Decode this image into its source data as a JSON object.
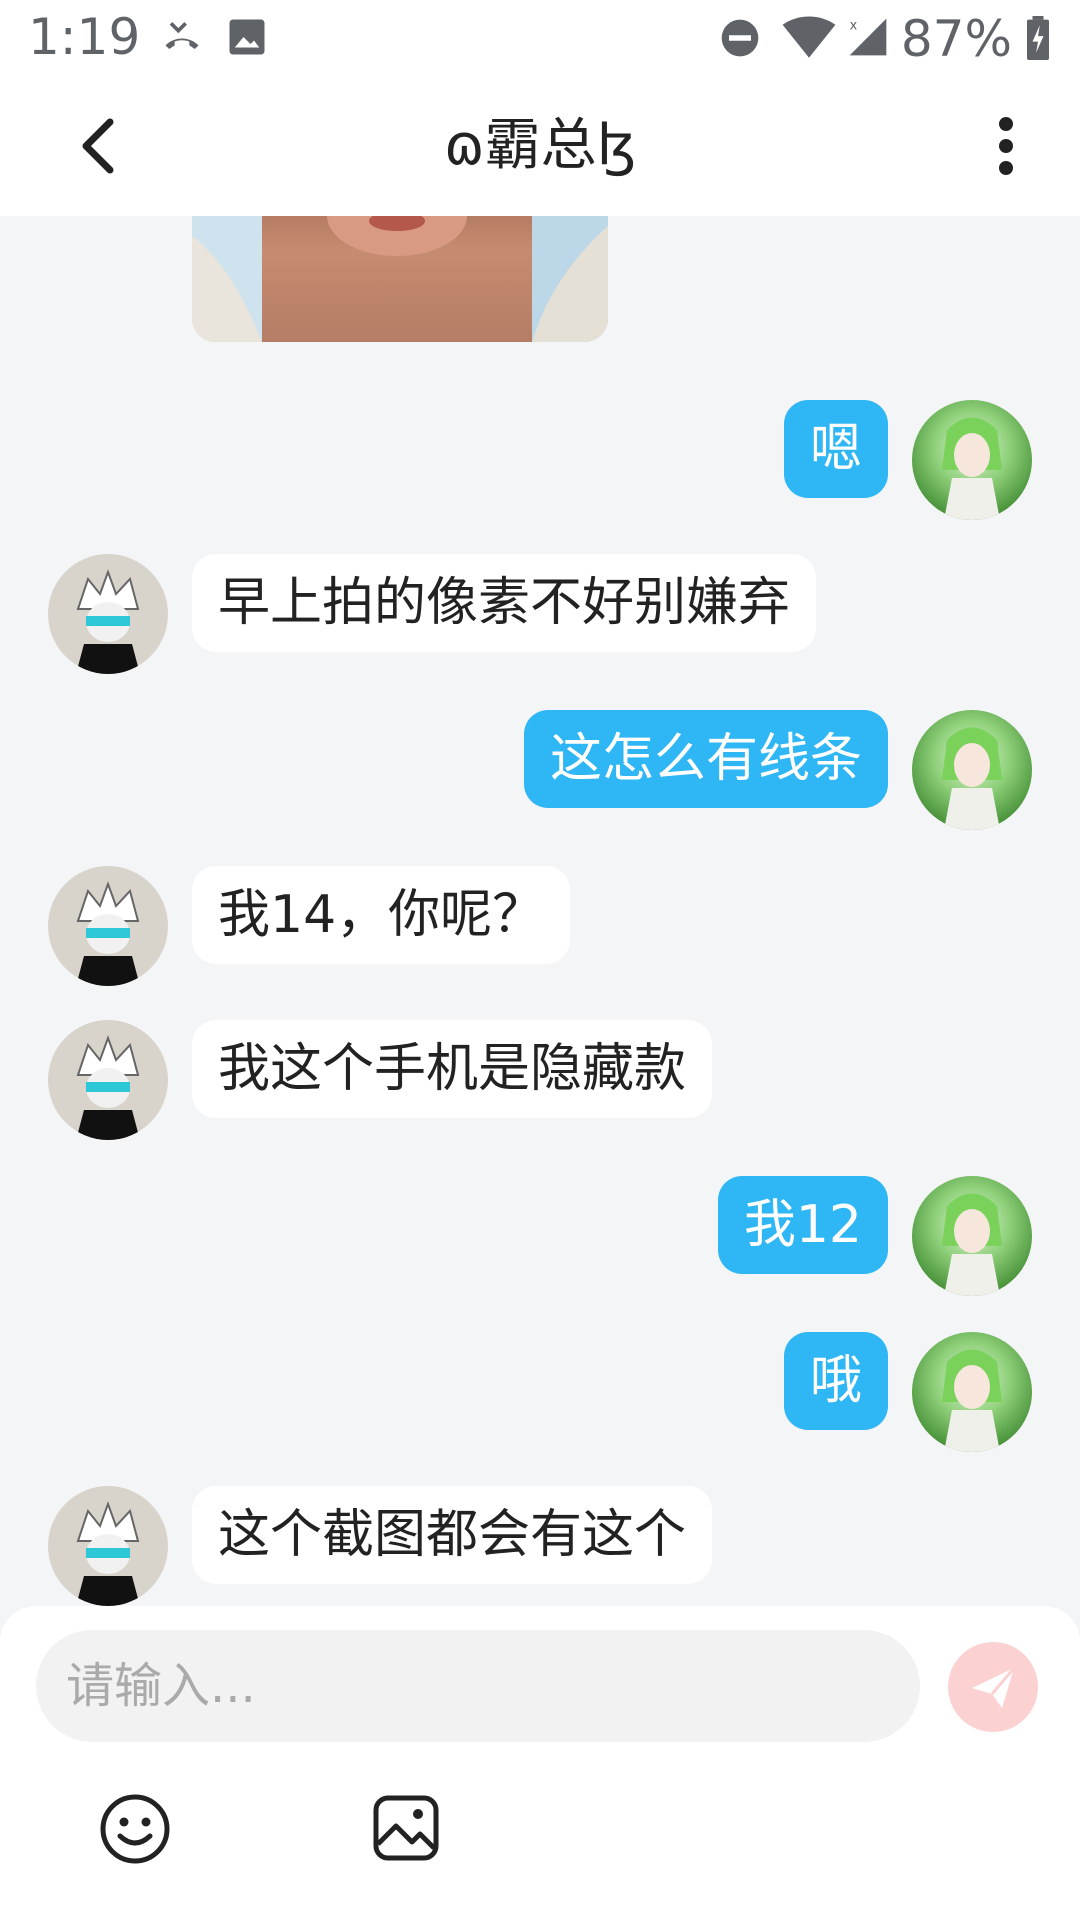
{
  "status_bar": {
    "time": "1:19",
    "battery": "87%"
  },
  "header": {
    "title": "ɷ霸总ɮ"
  },
  "messages": [
    {
      "side": "right",
      "text": "嗯"
    },
    {
      "side": "left",
      "text": "早上拍的像素不好别嫌弃"
    },
    {
      "side": "right",
      "text": "这怎么有线条"
    },
    {
      "side": "left",
      "text": "我14，你呢？"
    },
    {
      "side": "left",
      "text": "我这个手机是隐藏款"
    },
    {
      "side": "right",
      "text": "我12"
    },
    {
      "side": "right",
      "text": "哦"
    },
    {
      "side": "left",
      "text": "这个截图都会有这个"
    }
  ],
  "composer": {
    "placeholder": "请输入..."
  },
  "icons": {
    "back": "back-arrow-icon",
    "more": "more-vertical-icon",
    "send": "send-icon",
    "emoji": "emoji-icon",
    "image": "image-icon"
  },
  "colors": {
    "outgoing_bubble": "#2fb6f5",
    "incoming_bubble": "#ffffff",
    "send_button_disabled": "#fcd1d1"
  }
}
